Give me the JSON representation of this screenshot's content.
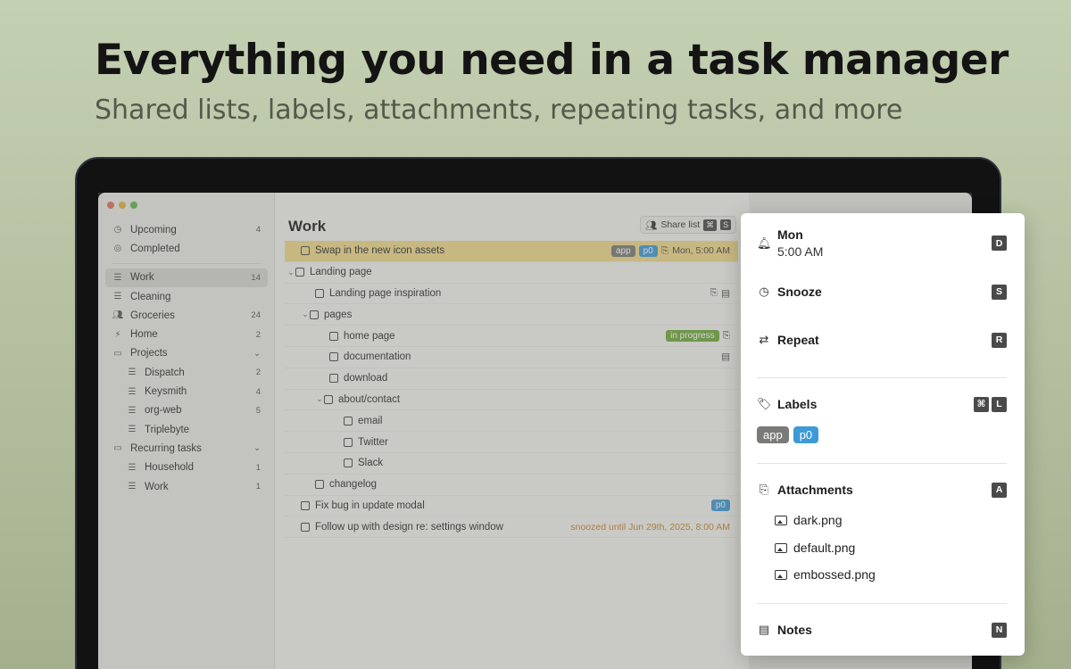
{
  "hero": {
    "headline": "Everything you need in a task manager",
    "subheadline": "Shared lists, labels, attachments, repeating tasks, and more"
  },
  "colors": {
    "label_app": "#7a7a78",
    "label_p0": "#3d9ad6",
    "in_progress": "#6fa73a",
    "snoozed_text": "#c9842c",
    "highlight_row": "#efd98c"
  },
  "sidebar": {
    "items": [
      {
        "label": "Upcoming",
        "count": "4",
        "icon": "clock-icon"
      },
      {
        "label": "Completed",
        "count": "",
        "icon": "check-circle-icon"
      },
      {
        "label": "Work",
        "count": "14",
        "icon": "list-icon"
      },
      {
        "label": "Cleaning",
        "count": "",
        "icon": "list-icon"
      },
      {
        "label": "Groceries",
        "count": "24",
        "icon": "people-icon"
      },
      {
        "label": "Home",
        "count": "2",
        "icon": "bolt-icon"
      },
      {
        "label": "Projects",
        "count": "",
        "icon": "folder-icon"
      },
      {
        "label": "Dispatch",
        "count": "2",
        "icon": "list-icon"
      },
      {
        "label": "Keysmith",
        "count": "4",
        "icon": "list-icon"
      },
      {
        "label": "org-web",
        "count": "5",
        "icon": "list-icon"
      },
      {
        "label": "Triplebyte",
        "count": "",
        "icon": "list-icon"
      },
      {
        "label": "Recurring tasks",
        "count": "",
        "icon": "folder-icon"
      },
      {
        "label": "Household",
        "count": "1",
        "icon": "list-icon"
      },
      {
        "label": "Work",
        "count": "1",
        "icon": "list-icon"
      }
    ]
  },
  "main": {
    "title": "Work",
    "share_label": "Share list",
    "share_keys": [
      "⌘",
      "S"
    ],
    "tasks": [
      {
        "label": "Swap in the new icon assets",
        "labels": [
          "app",
          "p0"
        ],
        "due": "Mon, 5:00 AM"
      },
      {
        "label": "Landing page"
      },
      {
        "label": "Landing page inspiration"
      },
      {
        "label": "pages"
      },
      {
        "label": "home page",
        "status": "in progress"
      },
      {
        "label": "documentation"
      },
      {
        "label": "download"
      },
      {
        "label": "about/contact"
      },
      {
        "label": "email"
      },
      {
        "label": "Twitter"
      },
      {
        "label": "Slack"
      },
      {
        "label": "changelog"
      },
      {
        "label": "Fix bug in update modal",
        "labels": [
          "p0"
        ]
      },
      {
        "label": "Follow up with design re: settings window",
        "snoozed": "snoozed until Jun 29th, 2025, 8:00 AM"
      }
    ]
  },
  "popup": {
    "due_day": "Mon",
    "due_time": "5:00 AM",
    "due_key": "D",
    "snooze_label": "Snooze",
    "snooze_key": "S",
    "repeat_label": "Repeat",
    "repeat_key": "R",
    "labels_label": "Labels",
    "labels_keys": [
      "⌘",
      "L"
    ],
    "labels": [
      "app",
      "p0"
    ],
    "attachments_label": "Attachments",
    "attachments_key": "A",
    "attachments": [
      "dark.png",
      "default.png",
      "embossed.png"
    ],
    "notes_label": "Notes",
    "notes_key": "N"
  }
}
